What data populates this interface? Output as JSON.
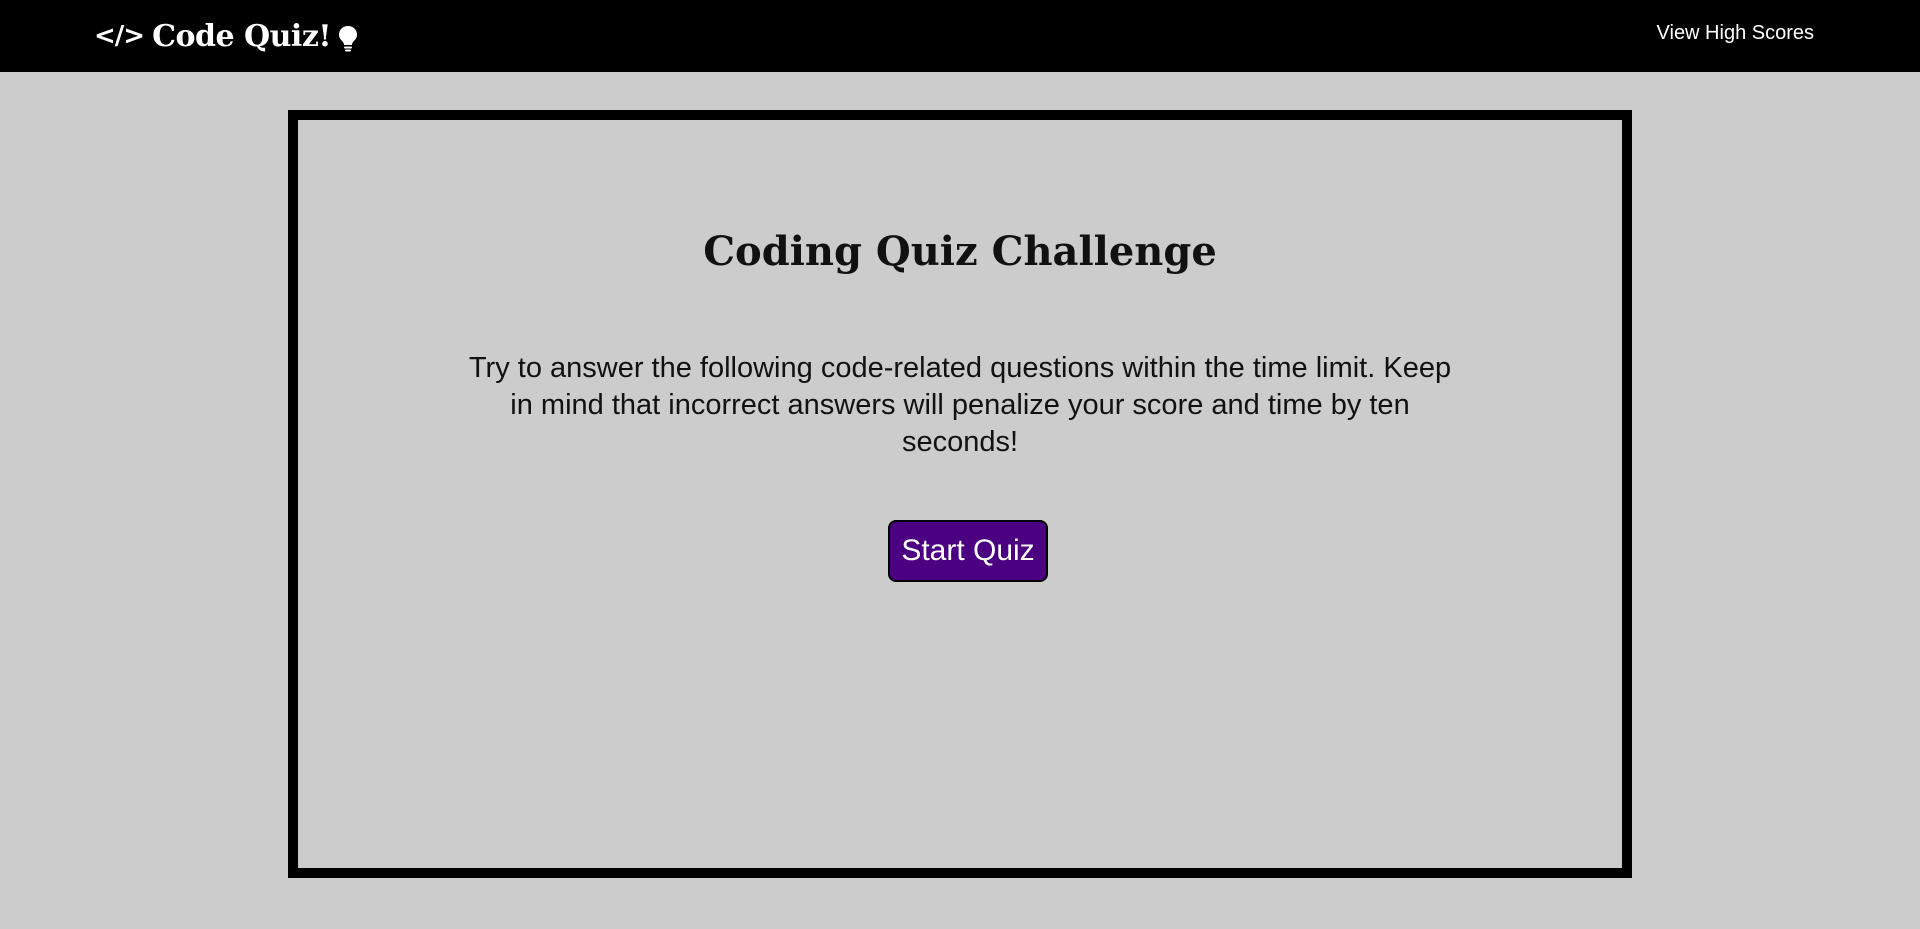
{
  "header": {
    "brand_icon": "code-icon",
    "brand_icon_text": "</>",
    "brand_title": "Code Quiz!",
    "brand_suffix_icon": "lightbulb-icon",
    "high_scores_link": "View High Scores"
  },
  "main": {
    "title": "Coding Quiz Challenge",
    "description": "Try to answer the following code-related questions within the time limit. Keep in mind that incorrect answers will penalize your score and time by ten seconds!",
    "start_button": "Start Quiz"
  },
  "colors": {
    "navbar_background": "#000000",
    "page_background": "#cccccc",
    "card_border": "#000000",
    "button_background": "#4b0082",
    "button_text": "#ffffff"
  }
}
